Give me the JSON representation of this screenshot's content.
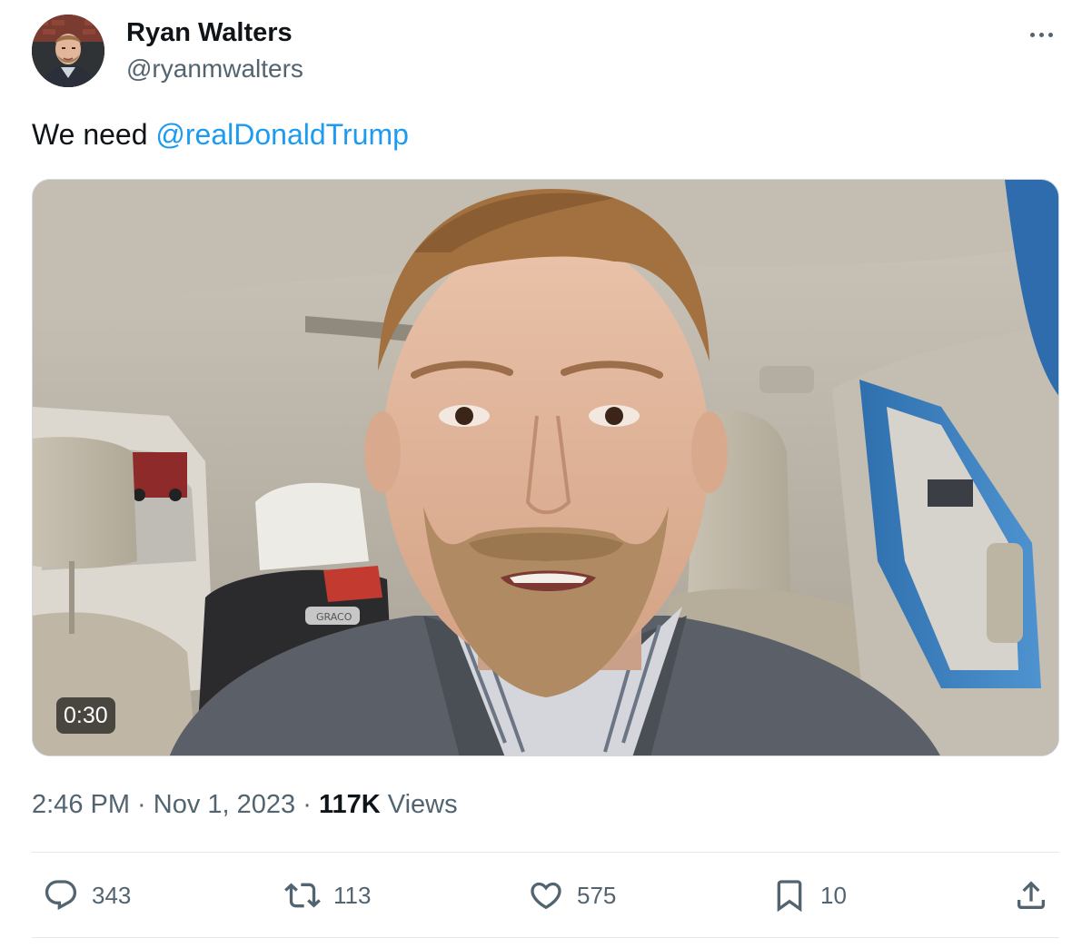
{
  "author": {
    "name": "Ryan Walters",
    "handle": "@ryanmwalters",
    "avatar_icon": "profile-photo"
  },
  "tweet": {
    "text_prefix": "We need ",
    "mention": "@realDonaldTrump"
  },
  "media": {
    "type": "video",
    "duration": "0:30",
    "seat_brand": "GRACO"
  },
  "meta": {
    "time": "2:46 PM",
    "separator1": " · ",
    "date": "Nov 1, 2023",
    "separator2": " · ",
    "views_count": "117K",
    "views_label": " Views"
  },
  "actions": {
    "replies": "343",
    "reposts": "113",
    "likes": "575",
    "bookmarks": "10"
  },
  "colors": {
    "link": "#1d9bf0",
    "secondary_text": "#536471",
    "primary_text": "#0f1419",
    "divider": "#e4e8eb"
  }
}
